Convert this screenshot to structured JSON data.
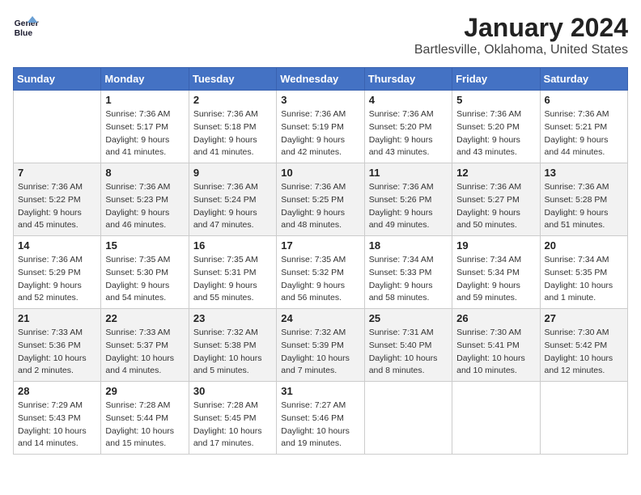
{
  "header": {
    "logo_line1": "General",
    "logo_line2": "Blue",
    "month_title": "January 2024",
    "location": "Bartlesville, Oklahoma, United States"
  },
  "weekdays": [
    "Sunday",
    "Monday",
    "Tuesday",
    "Wednesday",
    "Thursday",
    "Friday",
    "Saturday"
  ],
  "weeks": [
    [
      {
        "day": "",
        "sunrise": "",
        "sunset": "",
        "daylight": ""
      },
      {
        "day": "1",
        "sunrise": "Sunrise: 7:36 AM",
        "sunset": "Sunset: 5:17 PM",
        "daylight": "Daylight: 9 hours and 41 minutes."
      },
      {
        "day": "2",
        "sunrise": "Sunrise: 7:36 AM",
        "sunset": "Sunset: 5:18 PM",
        "daylight": "Daylight: 9 hours and 41 minutes."
      },
      {
        "day": "3",
        "sunrise": "Sunrise: 7:36 AM",
        "sunset": "Sunset: 5:19 PM",
        "daylight": "Daylight: 9 hours and 42 minutes."
      },
      {
        "day": "4",
        "sunrise": "Sunrise: 7:36 AM",
        "sunset": "Sunset: 5:20 PM",
        "daylight": "Daylight: 9 hours and 43 minutes."
      },
      {
        "day": "5",
        "sunrise": "Sunrise: 7:36 AM",
        "sunset": "Sunset: 5:20 PM",
        "daylight": "Daylight: 9 hours and 43 minutes."
      },
      {
        "day": "6",
        "sunrise": "Sunrise: 7:36 AM",
        "sunset": "Sunset: 5:21 PM",
        "daylight": "Daylight: 9 hours and 44 minutes."
      }
    ],
    [
      {
        "day": "7",
        "sunrise": "Sunrise: 7:36 AM",
        "sunset": "Sunset: 5:22 PM",
        "daylight": "Daylight: 9 hours and 45 minutes."
      },
      {
        "day": "8",
        "sunrise": "Sunrise: 7:36 AM",
        "sunset": "Sunset: 5:23 PM",
        "daylight": "Daylight: 9 hours and 46 minutes."
      },
      {
        "day": "9",
        "sunrise": "Sunrise: 7:36 AM",
        "sunset": "Sunset: 5:24 PM",
        "daylight": "Daylight: 9 hours and 47 minutes."
      },
      {
        "day": "10",
        "sunrise": "Sunrise: 7:36 AM",
        "sunset": "Sunset: 5:25 PM",
        "daylight": "Daylight: 9 hours and 48 minutes."
      },
      {
        "day": "11",
        "sunrise": "Sunrise: 7:36 AM",
        "sunset": "Sunset: 5:26 PM",
        "daylight": "Daylight: 9 hours and 49 minutes."
      },
      {
        "day": "12",
        "sunrise": "Sunrise: 7:36 AM",
        "sunset": "Sunset: 5:27 PM",
        "daylight": "Daylight: 9 hours and 50 minutes."
      },
      {
        "day": "13",
        "sunrise": "Sunrise: 7:36 AM",
        "sunset": "Sunset: 5:28 PM",
        "daylight": "Daylight: 9 hours and 51 minutes."
      }
    ],
    [
      {
        "day": "14",
        "sunrise": "Sunrise: 7:36 AM",
        "sunset": "Sunset: 5:29 PM",
        "daylight": "Daylight: 9 hours and 52 minutes."
      },
      {
        "day": "15",
        "sunrise": "Sunrise: 7:35 AM",
        "sunset": "Sunset: 5:30 PM",
        "daylight": "Daylight: 9 hours and 54 minutes."
      },
      {
        "day": "16",
        "sunrise": "Sunrise: 7:35 AM",
        "sunset": "Sunset: 5:31 PM",
        "daylight": "Daylight: 9 hours and 55 minutes."
      },
      {
        "day": "17",
        "sunrise": "Sunrise: 7:35 AM",
        "sunset": "Sunset: 5:32 PM",
        "daylight": "Daylight: 9 hours and 56 minutes."
      },
      {
        "day": "18",
        "sunrise": "Sunrise: 7:34 AM",
        "sunset": "Sunset: 5:33 PM",
        "daylight": "Daylight: 9 hours and 58 minutes."
      },
      {
        "day": "19",
        "sunrise": "Sunrise: 7:34 AM",
        "sunset": "Sunset: 5:34 PM",
        "daylight": "Daylight: 9 hours and 59 minutes."
      },
      {
        "day": "20",
        "sunrise": "Sunrise: 7:34 AM",
        "sunset": "Sunset: 5:35 PM",
        "daylight": "Daylight: 10 hours and 1 minute."
      }
    ],
    [
      {
        "day": "21",
        "sunrise": "Sunrise: 7:33 AM",
        "sunset": "Sunset: 5:36 PM",
        "daylight": "Daylight: 10 hours and 2 minutes."
      },
      {
        "day": "22",
        "sunrise": "Sunrise: 7:33 AM",
        "sunset": "Sunset: 5:37 PM",
        "daylight": "Daylight: 10 hours and 4 minutes."
      },
      {
        "day": "23",
        "sunrise": "Sunrise: 7:32 AM",
        "sunset": "Sunset: 5:38 PM",
        "daylight": "Daylight: 10 hours and 5 minutes."
      },
      {
        "day": "24",
        "sunrise": "Sunrise: 7:32 AM",
        "sunset": "Sunset: 5:39 PM",
        "daylight": "Daylight: 10 hours and 7 minutes."
      },
      {
        "day": "25",
        "sunrise": "Sunrise: 7:31 AM",
        "sunset": "Sunset: 5:40 PM",
        "daylight": "Daylight: 10 hours and 8 minutes."
      },
      {
        "day": "26",
        "sunrise": "Sunrise: 7:30 AM",
        "sunset": "Sunset: 5:41 PM",
        "daylight": "Daylight: 10 hours and 10 minutes."
      },
      {
        "day": "27",
        "sunrise": "Sunrise: 7:30 AM",
        "sunset": "Sunset: 5:42 PM",
        "daylight": "Daylight: 10 hours and 12 minutes."
      }
    ],
    [
      {
        "day": "28",
        "sunrise": "Sunrise: 7:29 AM",
        "sunset": "Sunset: 5:43 PM",
        "daylight": "Daylight: 10 hours and 14 minutes."
      },
      {
        "day": "29",
        "sunrise": "Sunrise: 7:28 AM",
        "sunset": "Sunset: 5:44 PM",
        "daylight": "Daylight: 10 hours and 15 minutes."
      },
      {
        "day": "30",
        "sunrise": "Sunrise: 7:28 AM",
        "sunset": "Sunset: 5:45 PM",
        "daylight": "Daylight: 10 hours and 17 minutes."
      },
      {
        "day": "31",
        "sunrise": "Sunrise: 7:27 AM",
        "sunset": "Sunset: 5:46 PM",
        "daylight": "Daylight: 10 hours and 19 minutes."
      },
      {
        "day": "",
        "sunrise": "",
        "sunset": "",
        "daylight": ""
      },
      {
        "day": "",
        "sunrise": "",
        "sunset": "",
        "daylight": ""
      },
      {
        "day": "",
        "sunrise": "",
        "sunset": "",
        "daylight": ""
      }
    ]
  ]
}
